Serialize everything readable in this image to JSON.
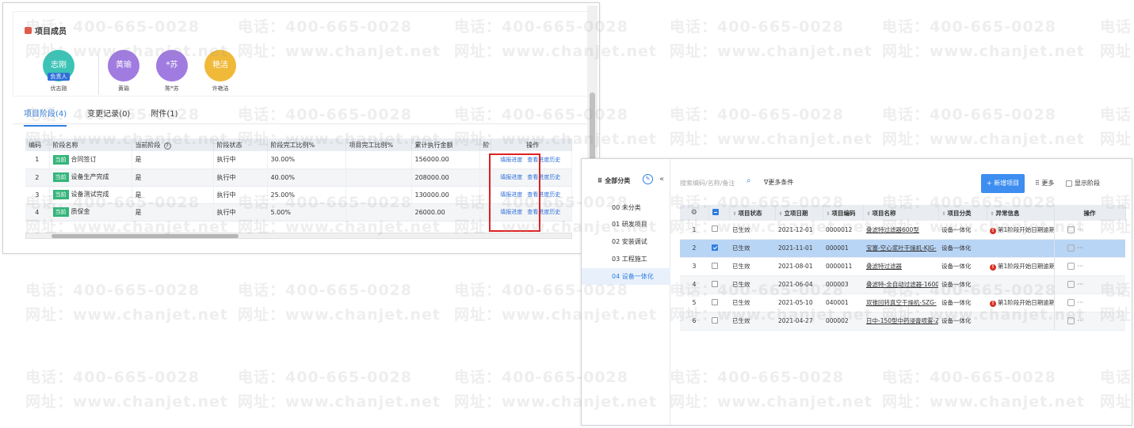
{
  "watermark": {
    "phone": "电话：400-665-0028",
    "site": "网址：www.chanjet.net"
  },
  "left": {
    "members_title": "项目成员",
    "members": [
      {
        "avatar_text": "志刚",
        "name": "优志刚",
        "color": "#3cc3b5",
        "tag": "负责人"
      },
      {
        "avatar_text": "黄瑜",
        "name": "黄瑜",
        "color": "#a07be0",
        "tag": ""
      },
      {
        "avatar_text": "*苏",
        "name": "陈*苏",
        "color": "#a07be0",
        "tag": ""
      },
      {
        "avatar_text": "艳洁",
        "name": "许艳洁",
        "color": "#f0b93a",
        "tag": ""
      }
    ],
    "tabs": [
      "项目阶段(4)",
      "变更记录(0)",
      "附件(1)"
    ],
    "columns": [
      "编码",
      "阶段名称",
      "当前阶段",
      "阶段状态",
      "阶段完工比例%",
      "项目完工比例%",
      "累计执行金额",
      "阶",
      "操作"
    ],
    "help_icon": "?",
    "rows": [
      {
        "no": "1",
        "badge": "当前",
        "name": "合同签订",
        "current": "是",
        "status": "执行中",
        "ratio": "30.00%",
        "proj_ratio": "",
        "amount": "156000.00"
      },
      {
        "no": "2",
        "badge": "当前",
        "name": "设备生产完成",
        "current": "是",
        "status": "执行中",
        "ratio": "40.00%",
        "proj_ratio": "",
        "amount": "208000.00"
      },
      {
        "no": "3",
        "badge": "当前",
        "name": "设备测试完成",
        "current": "是",
        "status": "执行中",
        "ratio": "25.00%",
        "proj_ratio": "",
        "amount": "130000.00"
      },
      {
        "no": "4",
        "badge": "当前",
        "name": "质保金",
        "current": "是",
        "status": "执行中",
        "ratio": "5.00%",
        "proj_ratio": "",
        "amount": "26000.00"
      }
    ],
    "action_fill": "填报进度",
    "action_history": "查看进度历史"
  },
  "right": {
    "sidebar_title": "全部分类",
    "grid_icon": "⠿",
    "edit_icon": "✎",
    "collapse_icon": "«",
    "categories": [
      "00 未分类",
      "01 研发项目",
      "02 安装调试",
      "03 工程施工",
      "04 设备一体化"
    ],
    "search_placeholder": "搜索编码/名称/备注",
    "search_icon": "⌕",
    "more_conditions": "∇更多条件",
    "new_button": "+ 新增项目",
    "more_button": "⠿ 更多",
    "show_phase": "显示阶段",
    "settings_icon": "⚙",
    "sort_icon": "⇕",
    "warn_icon": "!",
    "more_dots": "···",
    "columns": [
      "项目状态",
      "立项日期",
      "项目编码",
      "项目名称",
      "项目分类",
      "异常信息",
      "操作"
    ],
    "rows": [
      {
        "no": "1",
        "checked": false,
        "status": "已生效",
        "date": "2021-12-01",
        "code": "0000012",
        "name": "叠滤特过滤器600型",
        "category": "设备一体化",
        "warning": "第1阶段开始日期逾期3"
      },
      {
        "no": "2",
        "checked": true,
        "status": "已生效",
        "date": "2021-11-01",
        "code": "000001",
        "name": "宝塞-空心浆叶干燥机-KJG-",
        "category": "设备一体化",
        "warning": ""
      },
      {
        "no": "3",
        "checked": false,
        "status": "已生效",
        "date": "2021-08-01",
        "code": "0000011",
        "name": "叠滤特过滤器",
        "category": "设备一体化",
        "warning": "第1阶段开始日期逾期3"
      },
      {
        "no": "4",
        "checked": false,
        "status": "已生效",
        "date": "2021-06-04",
        "code": "000003",
        "name": "叠滤特-全自动过滤器-1600",
        "category": "设备一体化",
        "warning": ""
      },
      {
        "no": "5",
        "checked": false,
        "status": "已生效",
        "date": "2021-05-10",
        "code": "040001",
        "name": "双锥回转真空干燥机-SZG-",
        "category": "设备一体化",
        "warning": "第1阶段开始日期逾期2"
      },
      {
        "no": "6",
        "checked": false,
        "status": "已生效",
        "date": "2021-04-27",
        "code": "000002",
        "name": "日中-150型中药浸膏喷雾-Z",
        "category": "设备一体化",
        "warning": ""
      }
    ]
  }
}
